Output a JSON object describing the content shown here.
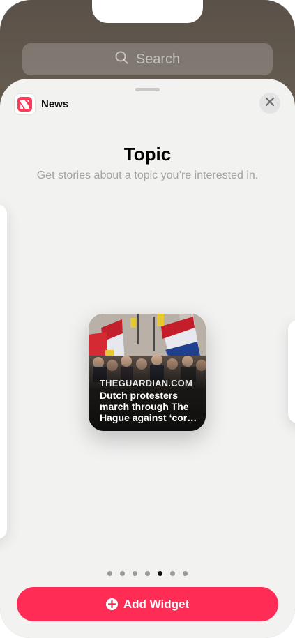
{
  "home": {
    "search_label": "Search",
    "search_icon": "magnifying-glass"
  },
  "sheet": {
    "app_name": "News",
    "app_icon": "news-app-icon",
    "close_icon": "close-x",
    "widget_title": "Topic",
    "widget_subtitle": "Get stories about a topic you’re interested in.",
    "widget": {
      "source": "THEGUARDIAN.COM",
      "headline": "Dutch protesters march through The Hague against ‘cor…"
    },
    "pagination": {
      "total": 7,
      "current": 5
    },
    "add_button_label": "Add Widget",
    "add_button_icon": "plus-circle",
    "accent_color": "#ff2d55"
  }
}
